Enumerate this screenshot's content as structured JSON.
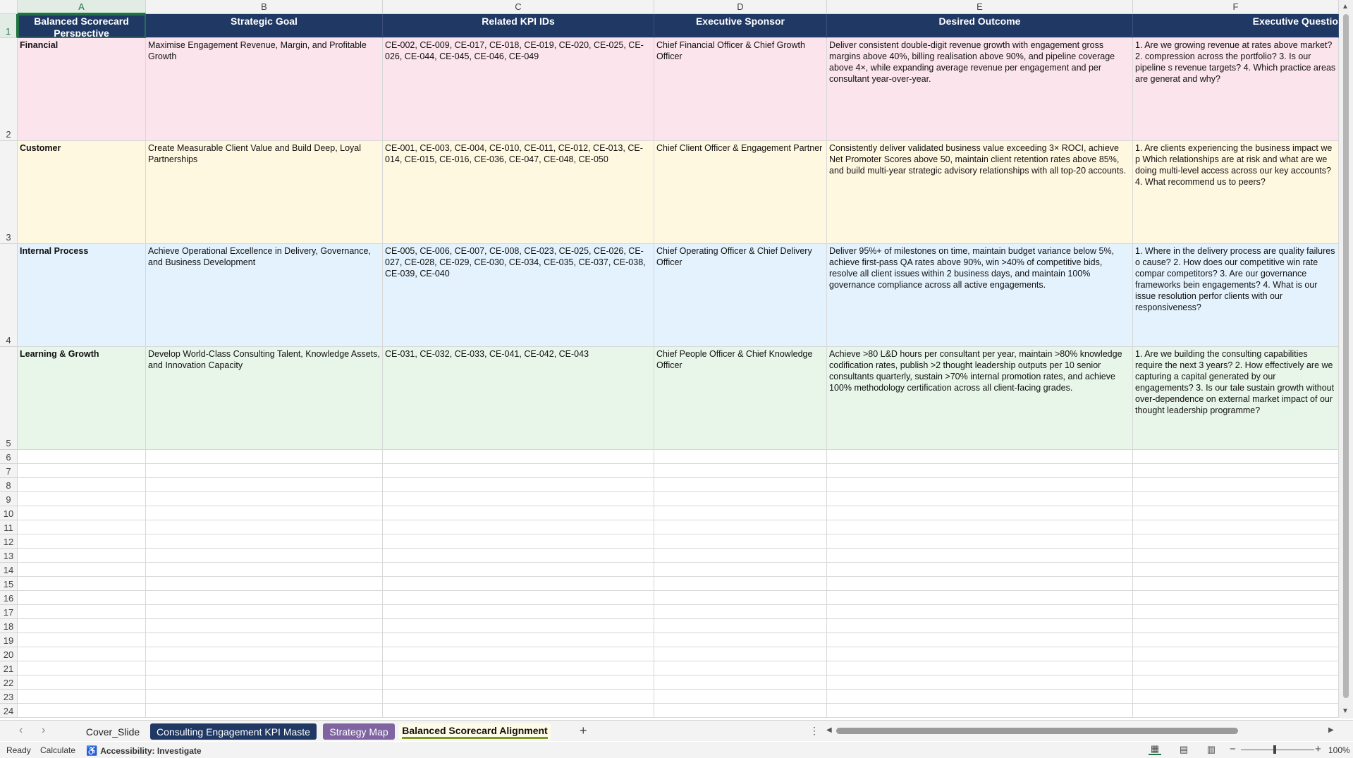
{
  "columns": [
    "A",
    "B",
    "C",
    "D",
    "E",
    "F"
  ],
  "active_column": "A",
  "active_row": "1",
  "header_row": {
    "row_number": "1",
    "cells": [
      "Balanced Scorecard Perspective",
      "Strategic Goal",
      "Related KPI IDs",
      "Executive Sponsor",
      "Desired Outcome",
      "Executive Questio"
    ]
  },
  "data_rows": [
    {
      "row_number": "2",
      "color": "#fce4ec",
      "perspective": "Financial",
      "goal": "Maximise Engagement Revenue, Margin, and Profitable Growth",
      "kpis": "CE-002, CE-009, CE-017, CE-018, CE-019, CE-020, CE-025, CE-026, CE-044, CE-045, CE-046, CE-049",
      "sponsor": "Chief Financial Officer & Chief Growth Officer",
      "outcome": "Deliver consistent double-digit revenue growth with engagement gross margins above 40%, billing realisation above 90%, and pipeline coverage above 4×, while expanding average revenue per engagement and per consultant year-over-year.",
      "questions": "1. Are we growing revenue at rates above market? 2. compression across the portfolio? 3. Is our pipeline s revenue targets? 4. Which practice areas are generat and why?"
    },
    {
      "row_number": "3",
      "color": "#fff8e1",
      "perspective": "Customer",
      "goal": "Create Measurable Client Value and Build Deep, Loyal Partnerships",
      "kpis": "CE-001, CE-003, CE-004, CE-010, CE-011, CE-012, CE-013, CE-014, CE-015, CE-016, CE-036, CE-047, CE-048, CE-050",
      "sponsor": "Chief Client Officer & Engagement Partner",
      "outcome": "Consistently deliver validated business value exceeding 3× ROCI, achieve Net Promoter Scores above 50, maintain client retention rates above 85%, and build multi-year strategic advisory relationships with all top-20 accounts.",
      "questions": "1. Are clients experiencing the business impact we p Which relationships are at risk and what are we doing multi-level access across our key accounts? 4. What recommend us to peers?"
    },
    {
      "row_number": "4",
      "color": "#e3f2fd",
      "perspective": "Internal Process",
      "goal": "Achieve Operational Excellence in Delivery, Governance, and Business Development",
      "kpis": "CE-005, CE-006, CE-007, CE-008, CE-023, CE-025, CE-026, CE-027, CE-028, CE-029, CE-030, CE-034, CE-035, CE-037, CE-038, CE-039, CE-040",
      "sponsor": "Chief Operating Officer & Chief Delivery Officer",
      "outcome": "Deliver 95%+ of milestones on time, maintain budget variance below 5%, achieve first-pass QA rates above 90%, win >40% of competitive bids, resolve all client issues within 2 business days, and maintain 100% governance compliance across all active engagements.",
      "questions": "1. Where in the delivery process are quality failures o cause? 2. How does our competitive win rate compar competitors? 3. Are our governance frameworks bein engagements? 4. What is our issue resolution perfor clients with our responsiveness?"
    },
    {
      "row_number": "5",
      "color": "#e8f5e9",
      "perspective": "Learning & Growth",
      "goal": "Develop World-Class Consulting Talent, Knowledge Assets, and Innovation Capacity",
      "kpis": "CE-031, CE-032, CE-033, CE-041, CE-042, CE-043",
      "sponsor": "Chief People Officer & Chief Knowledge Officer",
      "outcome": "Achieve >80 L&D hours per consultant per year, maintain >80% knowledge codification rates, publish >2 thought leadership outputs per 10 senior consultants quarterly, sustain >70% internal promotion rates, and achieve 100% methodology certification across all client-facing grades.",
      "questions": "1. Are we building the consulting capabilities require the next 3 years? 2. How effectively are we capturing a capital generated by our engagements? 3. Is our tale sustain growth without over-dependence on external market impact of our thought leadership programme?"
    }
  ],
  "empty_rows": [
    "6",
    "7",
    "8",
    "9",
    "10",
    "11",
    "12",
    "13",
    "14",
    "15",
    "16",
    "17",
    "18",
    "19",
    "20",
    "21",
    "22",
    "23",
    "24"
  ],
  "sheet_tabs": {
    "cover": "Cover_Slide",
    "kpi": "Consulting Engagement KPI Maste",
    "strategy": "Strategy Map",
    "bsc": "Balanced Scorecard Alignment",
    "add": "+",
    "more": "⋮"
  },
  "tab_colors": {
    "kpi": "#1f3864",
    "strategy": "#8064a2",
    "active_underline": "#7a9a2a"
  },
  "status": {
    "ready": "Ready",
    "calculate": "Calculate",
    "accessibility": "Accessibility: Investigate",
    "zoom": "100%"
  },
  "icons": {
    "prev_sheet": "chevron-left-icon",
    "next_sheet": "chevron-right-icon",
    "accessibility": "accessibility-icon",
    "normal_view": "grid-view-icon",
    "page_layout": "page-layout-icon",
    "page_break": "page-break-icon"
  }
}
